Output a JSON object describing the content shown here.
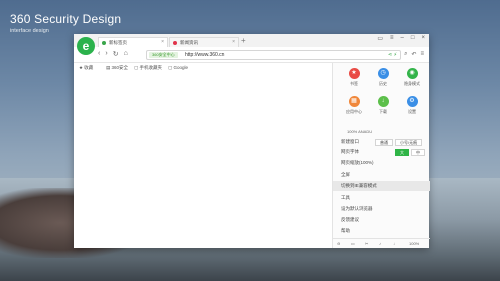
{
  "brand": {
    "title": "360 Security Design",
    "subtitle": "interface design"
  },
  "tabs": [
    {
      "label": "新标签页",
      "color": "#3aa64b"
    },
    {
      "label": "新闻资讯",
      "color": "#e0334a"
    }
  ],
  "toolbar": {
    "secure_label": "360安全中心",
    "url": "http://www.360.cn"
  },
  "bookmarks": [
    "收藏",
    "360安全",
    "手机收藏夹",
    "Google"
  ],
  "menu": {
    "icons": [
      {
        "label": "书签",
        "color": "#e94b45"
      },
      {
        "label": "历史",
        "color": "#3b8fe6"
      },
      {
        "label": "隐身模式",
        "color": "#34b44a"
      },
      {
        "label": "应用中心",
        "color": "#f0873a"
      },
      {
        "label": "下载",
        "color": "#5cbf4a"
      },
      {
        "label": "设置",
        "color": "#3b8fe6"
      }
    ],
    "zoom_text": "100% ANADU",
    "rows": [
      {
        "label": "新建窗口",
        "pills": [
          "普通",
          "小号/无痕"
        ],
        "on": -1
      },
      {
        "label": "网页字体",
        "pills": [
          "大",
          "中"
        ],
        "on": 0
      },
      {
        "label": "网页缩放(100%)",
        "pills": [],
        "on": -1
      },
      {
        "label": "全屏",
        "pills": [],
        "on": -1
      },
      {
        "label": "切换到IE兼容模式",
        "pills": [],
        "on": -1,
        "hl": true
      },
      {
        "label": "工具",
        "pills": [],
        "on": -1
      },
      {
        "label": "设为默认浏览器",
        "pills": [],
        "on": -1
      },
      {
        "label": "反馈建议",
        "pills": [],
        "on": -1
      },
      {
        "label": "帮助",
        "pills": [],
        "on": -1
      }
    ],
    "bottom": {
      "zoom": "100%"
    }
  }
}
